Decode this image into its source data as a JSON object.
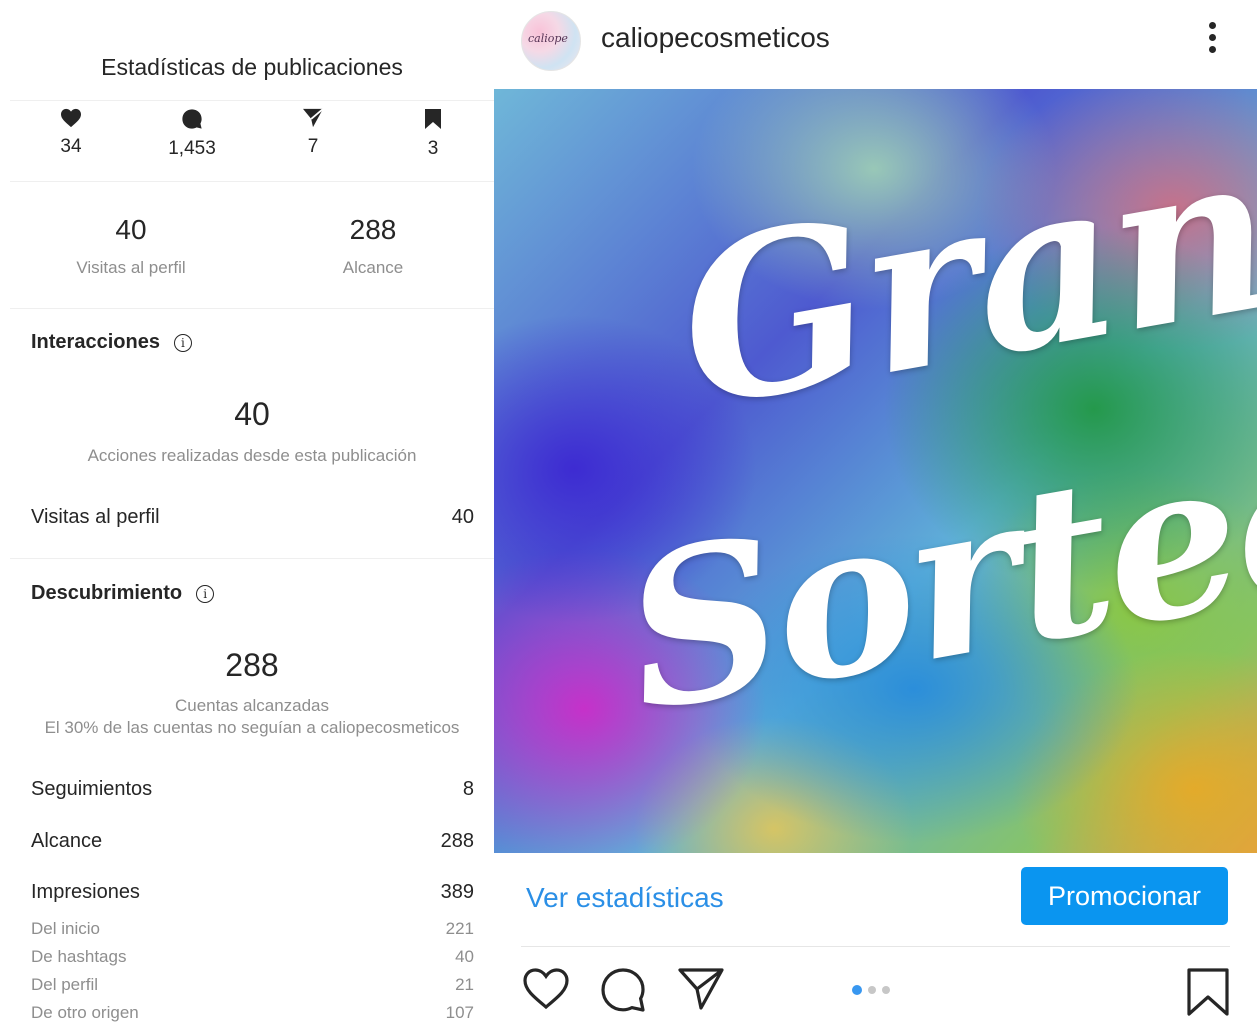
{
  "insights": {
    "title": "Estadísticas de publicaciones",
    "icon_stats": [
      {
        "icon": "heart-icon",
        "value": "34"
      },
      {
        "icon": "comment-icon",
        "value": "1,453"
      },
      {
        "icon": "share-icon",
        "value": "7"
      },
      {
        "icon": "bookmark-icon",
        "value": "3"
      }
    ],
    "profile_visits": {
      "value": "40",
      "label": "Visitas al perfil"
    },
    "reach": {
      "value": "288",
      "label": "Alcance"
    },
    "interactions": {
      "heading": "Interacciones",
      "total": "40",
      "caption": "Acciones realizadas desde esta publicación",
      "rows": [
        {
          "label": "Visitas al perfil",
          "value": "40"
        }
      ]
    },
    "discovery": {
      "heading": "Descubrimiento",
      "total": "288",
      "caption": "Cuentas alcanzadas",
      "subcaption": "El 30% de las cuentas no seguían a caliopecosmeticos",
      "rows": [
        {
          "label": "Seguimientos",
          "value": "8"
        },
        {
          "label": "Alcance",
          "value": "288"
        },
        {
          "label": "Impresiones",
          "value": "389"
        }
      ],
      "impression_sources": [
        {
          "label": "Del inicio",
          "value": "221"
        },
        {
          "label": "De hashtags",
          "value": "40"
        },
        {
          "label": "Del perfil",
          "value": "21"
        },
        {
          "label": "De otro origen",
          "value": "107"
        }
      ]
    }
  },
  "post": {
    "username": "caliopecosmeticos",
    "avatar_text": "caliope",
    "image_text_line1": "Gran",
    "image_text_line2": "Sorteo",
    "view_insights_label": "Ver estadísticas",
    "promote_label": "Promocionar",
    "carousel_count": 3,
    "carousel_active": 1
  },
  "colors": {
    "accent": "#0a95f0",
    "link": "#2b8fe6",
    "muted": "#8e8e8e",
    "text": "#262626"
  }
}
